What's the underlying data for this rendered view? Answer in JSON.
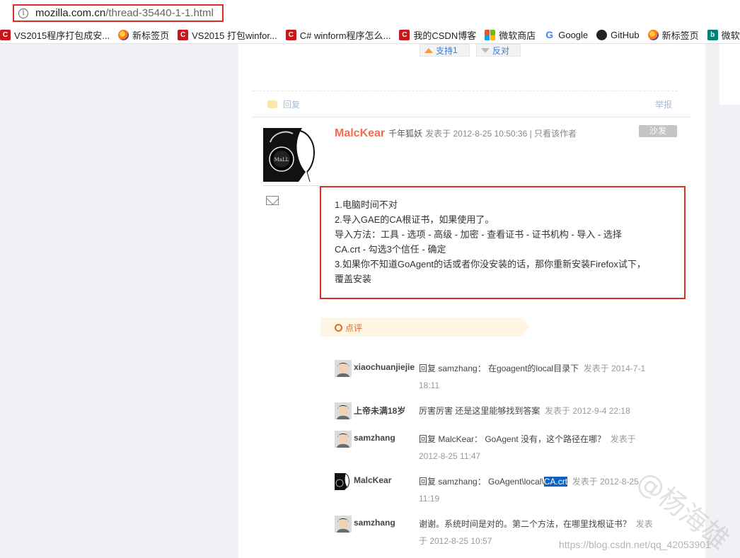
{
  "browser": {
    "url_host": "mozilla.com.cn",
    "url_path": "/thread-35440-1-1.html",
    "info_icon": "i",
    "bookmarks": [
      {
        "icon": "csdn-icon",
        "label": "VS2015程序打包成安..."
      },
      {
        "icon": "firefox-icon",
        "label": "新标签页"
      },
      {
        "icon": "csdn-icon",
        "label": "VS2015 打包winfor..."
      },
      {
        "icon": "csdn-icon",
        "label": "C# winform程序怎么..."
      },
      {
        "icon": "csdn-icon",
        "label": "我的CSDN博客"
      },
      {
        "icon": "microsoft-icon",
        "label": "微软商店"
      },
      {
        "icon": "google-icon",
        "label": "Google"
      },
      {
        "icon": "github-icon",
        "label": "GitHub"
      },
      {
        "icon": "firefox-icon",
        "label": "新标签页"
      },
      {
        "icon": "bing-icon",
        "label": "微软"
      }
    ]
  },
  "votes": {
    "support_label": "支持",
    "support_count": "1",
    "oppose_label": "反对"
  },
  "actions": {
    "reply_label": "回复",
    "report_label": "举报"
  },
  "post": {
    "author": "MalcKear",
    "rank": "千年狐妖",
    "meta": "发表于 2012-8-25 10:50:36 | 只看该作者",
    "floor": "沙发",
    "avatar_text": "MaLL",
    "lines": [
      "1.电脑时间不对",
      "2.导入GAE的CA根证书，如果使用了。",
      "导入方法：工具 - 选项 - 高级 - 加密 - 查看证书 - 证书机构 - 导入 - 选择",
      "CA.crt - 勾选3个信任 - 确定",
      "3.如果你不知道GoAgent的话或者你没安装的话，那你重新安装Firefox试下，",
      "覆盖安装"
    ]
  },
  "comments": {
    "tab_label": "点评",
    "items": [
      {
        "user": "xiaochuanjiejie",
        "text": "回复 samzhang： 在goagent的local目录下",
        "time": "发表于 2014-7-1 18:11"
      },
      {
        "user": "上帝未满18岁",
        "text": "厉害厉害 还是这里能够找到答案",
        "time": "发表于 2012-9-4 22:18"
      },
      {
        "user": "samzhang",
        "text": "回复 MalcKear： GoAgent 没有，这个路径在哪？",
        "time": "发表于 2012-8-25 11:47"
      },
      {
        "user": "MalcKear",
        "text": "回复 samzhang： GoAgent\\local\\",
        "highlight": "CA.crt",
        "time": "发表于 2012-8-25 11:19"
      },
      {
        "user": "samzhang",
        "text": "谢谢。系统时间是对的。第二个方法，在哪里找根证书？",
        "time": "发表于 2012-8-25 10:57"
      }
    ]
  },
  "watermark": {
    "text": "@杨海雄",
    "blog_url": "https://blog.csdn.net/qq_42053901"
  }
}
